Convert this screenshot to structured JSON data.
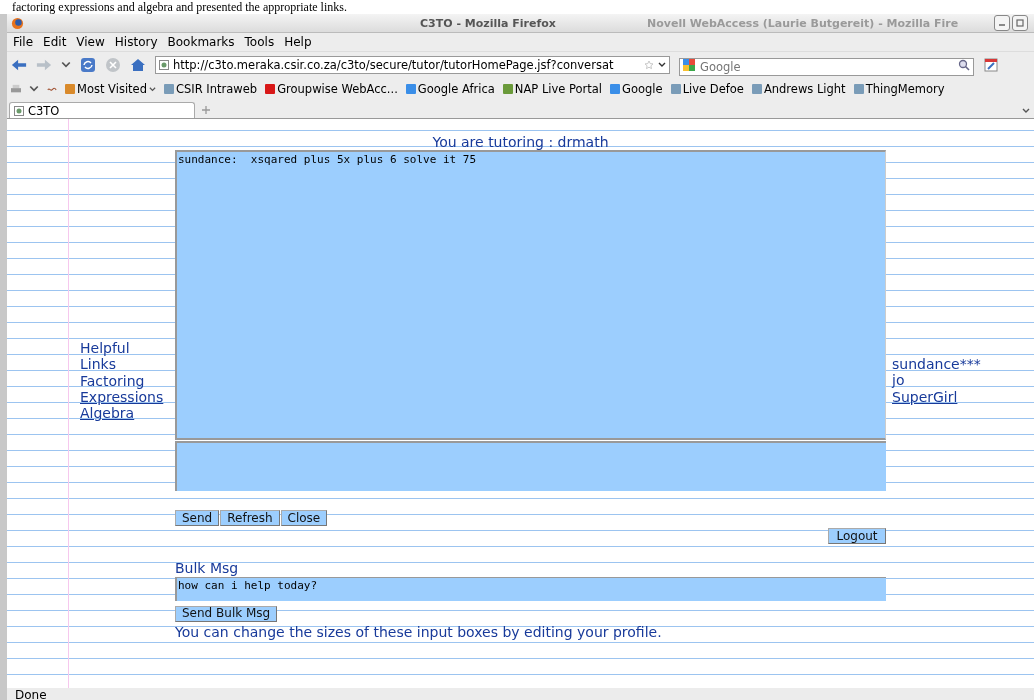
{
  "document_caption": "factoring expressions and algebra and presented the appropriate links.",
  "window": {
    "title": "C3TO - Mozilla Firefox",
    "background_title": "Novell WebAccess (Laurie Butgereit) - Mozilla Fire"
  },
  "menu": [
    "File",
    "Edit",
    "View",
    "History",
    "Bookmarks",
    "Tools",
    "Help"
  ],
  "address": {
    "value": "http://c3to.meraka.csir.co.za/c3to/secure/tutor/tutorHomePage.jsf?conversat"
  },
  "search": {
    "placeholder": "Google"
  },
  "bookmarks": [
    {
      "label": "Most Visited",
      "kind": "folder"
    },
    {
      "label": "CSIR Intraweb",
      "kind": "page"
    },
    {
      "label": "Groupwise WebAcc...",
      "kind": "novell"
    },
    {
      "label": "Google Africa",
      "kind": "google"
    },
    {
      "label": "NAP Live Portal",
      "kind": "nap"
    },
    {
      "label": "Google",
      "kind": "google"
    },
    {
      "label": "Live Defoe",
      "kind": "page"
    },
    {
      "label": "Andrews Light",
      "kind": "page"
    },
    {
      "label": "ThingMemory",
      "kind": "page"
    }
  ],
  "tabs": [
    {
      "label": "C3TO",
      "selected": true
    }
  ],
  "page": {
    "heading": "You are tutoring : drmath",
    "helpful_links": {
      "title": "Helpful Links",
      "links": [
        {
          "label": "Factoring",
          "underlined": false
        },
        {
          "label": "Expressions",
          "underlined": true
        },
        {
          "label": "Algebra",
          "underlined": true
        }
      ]
    },
    "chat_log": "sundance:  xsqared plus 5x plus 6 solve it 75",
    "users": [
      {
        "label": "sundance***",
        "underlined": false
      },
      {
        "label": "jo",
        "underlined": false
      },
      {
        "label": "SuperGirl",
        "underlined": true
      }
    ],
    "buttons": [
      "Send",
      "Refresh",
      "Close"
    ],
    "logout": "Logout",
    "bulk_label": "Bulk Msg",
    "bulk_value": "how can i help today?",
    "bulk_button": "Send Bulk Msg",
    "note": "You can change the sizes of these input boxes by editing your profile."
  },
  "status_bar": "Done"
}
